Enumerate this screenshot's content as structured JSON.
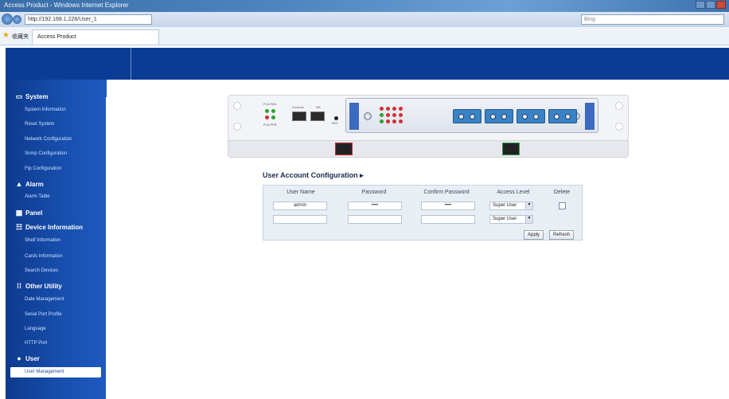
{
  "browser": {
    "title": "Access Product - Windows Internet Explorer",
    "url": "http://192.168.1.226/User_1",
    "search_placeholder": "Bing",
    "favorites_label": "收藏夹",
    "tab_title": "Access Product"
  },
  "sidebar": {
    "sections": [
      {
        "label": "System",
        "icon": "monitor-icon",
        "items": [
          "System Information",
          "Reset System",
          "Network Configuration",
          "Snmp Configuration",
          "Ftp Configuration"
        ]
      },
      {
        "label": "Alarm",
        "icon": "warning-icon",
        "items": [
          "Alarm Table"
        ]
      },
      {
        "label": "Panel",
        "icon": "panel-icon",
        "items": []
      },
      {
        "label": "Device Information",
        "icon": "device-icon",
        "items": [
          "Shelf Information",
          "Cards Information",
          "Search Devices"
        ]
      },
      {
        "label": "Other Utility",
        "icon": "utility-icon",
        "items": [
          "Date Management",
          "Serial Port Profile",
          "Language",
          "HTTP Port"
        ]
      },
      {
        "label": "User",
        "icon": "user-icon",
        "items": [
          "User Management"
        ]
      }
    ],
    "active_item": "User Management"
  },
  "device": {
    "status_labels": [
      "PLA FAN",
      "PLA PFR"
    ],
    "port_labels": [
      "Console",
      "NS"
    ],
    "button_label": "RST"
  },
  "config": {
    "title": "User Account Configuration ▸",
    "columns": [
      "User Name",
      "Password",
      "Confirm Password",
      "Access Level",
      "Delete"
    ],
    "rows": [
      {
        "user_name": "admin",
        "password": "••••",
        "confirm_password": "••••",
        "access_level": "Super User",
        "delete": false
      },
      {
        "user_name": "",
        "password": "",
        "confirm_password": "",
        "access_level": "Super User"
      }
    ],
    "apply_label": "Apply",
    "refresh_label": "Refresh"
  }
}
